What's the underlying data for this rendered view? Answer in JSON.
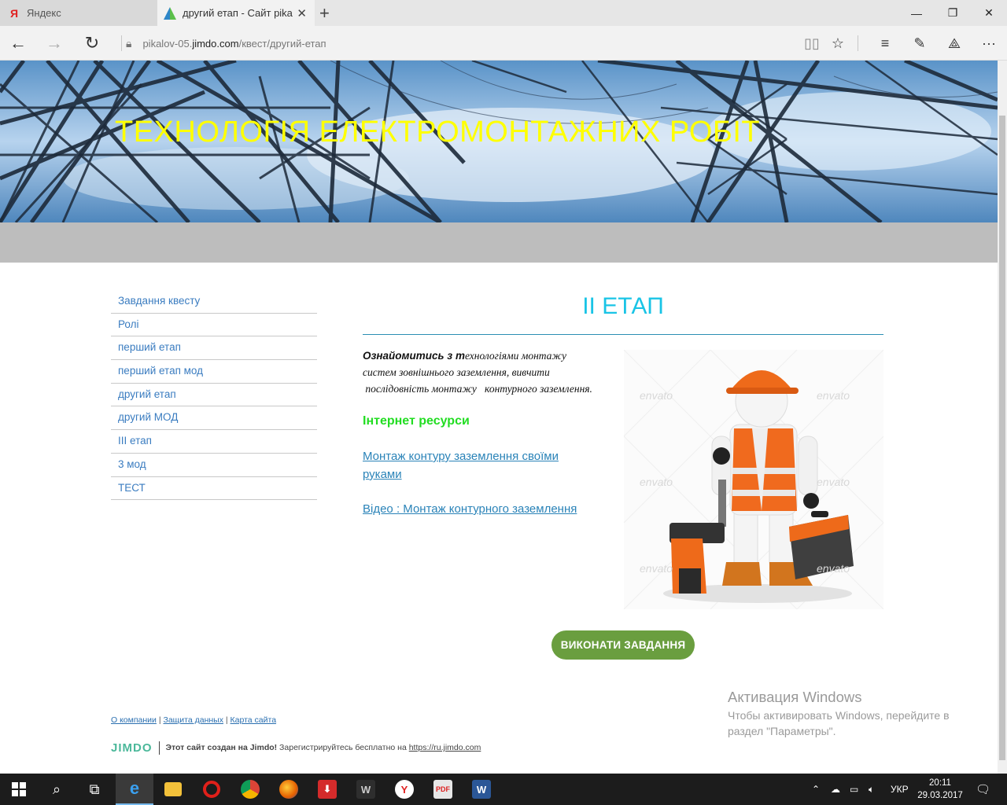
{
  "browser": {
    "tabs": [
      {
        "title": "Яндекс",
        "icon": "yandex-icon"
      },
      {
        "title": "другий етап - Сайт pika",
        "icon": "jimdo-icon",
        "active": true
      }
    ],
    "url_domain_prefix": "pikalov-05.",
    "url_domain": "jimdo.com",
    "url_path": "/квест/другий-етап"
  },
  "site": {
    "header_title": "ТЕХНОЛОГІЯ ЕЛЕКТРОМОНТАЖНИХ РОБІТ",
    "nav": [
      "Завдання квесту",
      "Ролі",
      "перший етап",
      "перший етап мод",
      "другий етап",
      "другий МОД",
      "ІІІ етап",
      "3 мод",
      "ТЕСТ"
    ],
    "stage_title": "II ЕТАП",
    "intro_bold": "Ознайомитись з т",
    "intro_line1_rest": "ехнологіями монтажу",
    "intro_line2": "систем  зовнішнього заземлення, вивчити",
    "intro_line3": " послідовність монтажу   контурного заземлення.",
    "resources_heading": "Інтернет ресурси",
    "link1": "Монтаж контуру заземлення своїми руками",
    "link2": "Відео : Монтаж контурного заземлення",
    "watermark": "envato",
    "cta_button": "ВИКОНАТИ ЗАВДАННЯ",
    "footer": {
      "links": [
        "О компании",
        "Защита данных",
        "Карта сайта"
      ],
      "jimdo_logo": "JIMDO",
      "created_bold": "Этот сайт создан на Jimdo!",
      "created_rest": " Зарегистрируйтесь бесплатно на ",
      "jimdo_url": "https://ru.jimdo.com"
    }
  },
  "activation": {
    "title": "Активация Windows",
    "line1": "Чтобы активировать Windows, перейдите в",
    "line2": "раздел \"Параметры\"."
  },
  "taskbar": {
    "language": "УКР",
    "time": "20:11",
    "date": "29.03.2017"
  },
  "colors": {
    "header_title": "#ffff00",
    "stage_title": "#19c4e6",
    "resources_heading": "#22dd22",
    "link": "#2a83b8",
    "cta": "#6a9e3f"
  }
}
